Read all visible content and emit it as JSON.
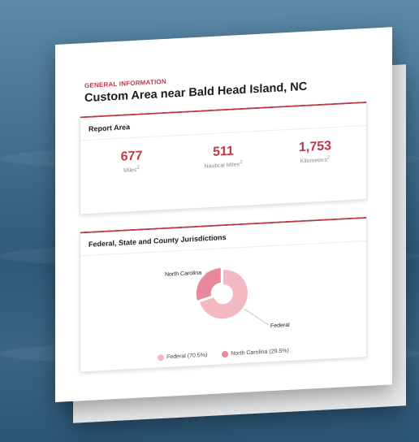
{
  "card": {
    "eyebrow": "GENERAL INFORMATION",
    "title": "Custom Area near Bald Head Island, NC"
  },
  "report_area": {
    "heading": "Report Area",
    "stats": [
      {
        "value": "677",
        "unit": "Miles",
        "superscript": "2"
      },
      {
        "value": "511",
        "unit": "Nautical Miles",
        "superscript": "2"
      },
      {
        "value": "1,753",
        "unit": "Kilometers",
        "superscript": "2"
      }
    ]
  },
  "jurisdictions": {
    "heading": "Federal, State and County Jurisdictions",
    "legend": [
      {
        "label": "Federal (70.5%)",
        "color": "#f4b8c3"
      },
      {
        "label": "North Carolina (29.5%)",
        "color": "#e9889a"
      }
    ]
  },
  "chart_data": {
    "type": "pie",
    "variant": "donut",
    "categories": [
      "Federal",
      "North Carolina"
    ],
    "values": [
      70.5,
      29.5
    ],
    "colors": [
      "#f4b8c3",
      "#e9889a"
    ],
    "title": "Federal, State and County Jurisdictions",
    "slice_labels": [
      "Federal",
      "North Carolina"
    ],
    "legend_placement": "bottom"
  },
  "colors": {
    "accent": "#c0374a"
  }
}
